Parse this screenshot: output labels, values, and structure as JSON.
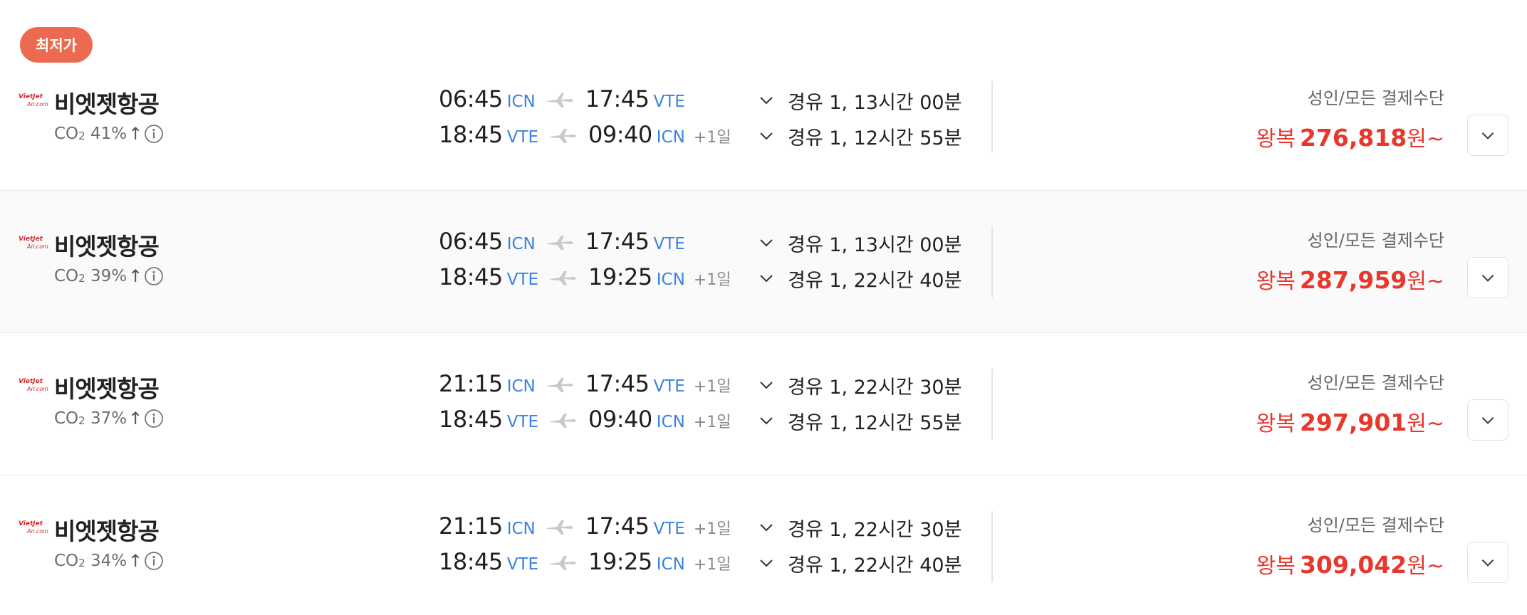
{
  "badge": "최저가",
  "common": {
    "airline": "비엣젯항공",
    "co2_prefix": "CO",
    "co2_sub": "2",
    "payment_label": "성인/모든 결제수단",
    "roundtrip_label": "왕복",
    "won_suffix": "원~",
    "colors": {
      "accent_red": "#e8372c",
      "code_blue": "#3b82e0",
      "badge": "#ec6a4f"
    }
  },
  "flights": [
    {
      "co2_pct": "41%",
      "out": {
        "dep_time": "06:45",
        "dep_code": "ICN",
        "arr_time": "17:45",
        "arr_code": "VTE",
        "plus": "",
        "stop": "경유 1, 13시간 00분"
      },
      "ret": {
        "dep_time": "18:45",
        "dep_code": "VTE",
        "arr_time": "09:40",
        "arr_code": "ICN",
        "plus": "+1일",
        "stop": "경유 1, 12시간 55분"
      },
      "price": "276,818"
    },
    {
      "co2_pct": "39%",
      "out": {
        "dep_time": "06:45",
        "dep_code": "ICN",
        "arr_time": "17:45",
        "arr_code": "VTE",
        "plus": "",
        "stop": "경유 1, 13시간 00분"
      },
      "ret": {
        "dep_time": "18:45",
        "dep_code": "VTE",
        "arr_time": "19:25",
        "arr_code": "ICN",
        "plus": "+1일",
        "stop": "경유 1, 22시간 40분"
      },
      "price": "287,959"
    },
    {
      "co2_pct": "37%",
      "out": {
        "dep_time": "21:15",
        "dep_code": "ICN",
        "arr_time": "17:45",
        "arr_code": "VTE",
        "plus": "+1일",
        "stop": "경유 1, 22시간 30분"
      },
      "ret": {
        "dep_time": "18:45",
        "dep_code": "VTE",
        "arr_time": "09:40",
        "arr_code": "ICN",
        "plus": "+1일",
        "stop": "경유 1, 12시간 55분"
      },
      "price": "297,901"
    },
    {
      "co2_pct": "34%",
      "out": {
        "dep_time": "21:15",
        "dep_code": "ICN",
        "arr_time": "17:45",
        "arr_code": "VTE",
        "plus": "+1일",
        "stop": "경유 1, 22시간 30분"
      },
      "ret": {
        "dep_time": "18:45",
        "dep_code": "VTE",
        "arr_time": "19:25",
        "arr_code": "ICN",
        "plus": "+1일",
        "stop": "경유 1, 22시간 40분"
      },
      "price": "309,042"
    }
  ]
}
